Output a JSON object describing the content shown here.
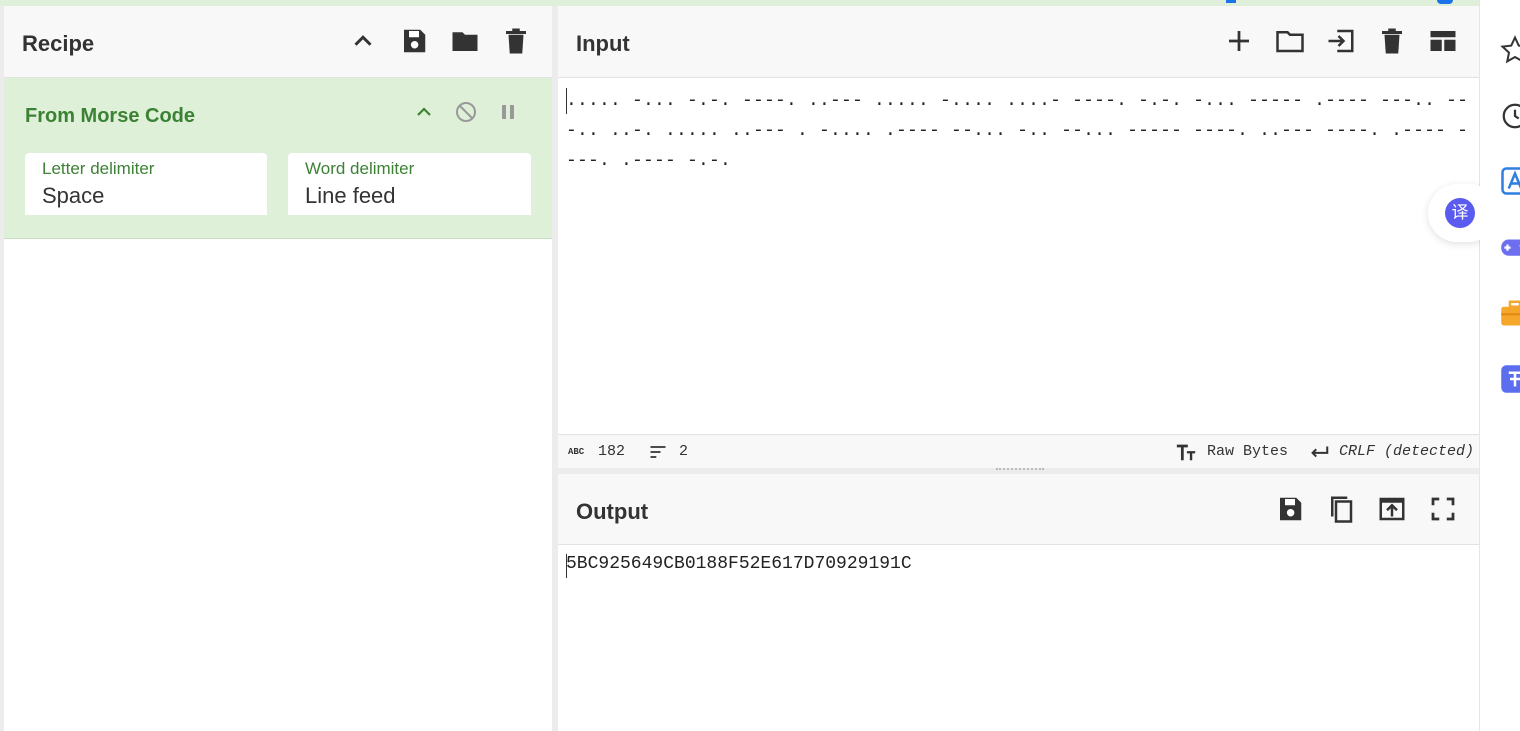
{
  "recipe": {
    "title": "Recipe",
    "icons": [
      "chevron-up-icon",
      "save-icon",
      "folder-icon",
      "trash-icon"
    ],
    "operation": {
      "name": "From Morse Code",
      "args": [
        {
          "label": "Letter delimiter",
          "value": "Space"
        },
        {
          "label": "Word delimiter",
          "value": "Line feed"
        }
      ]
    }
  },
  "input": {
    "title": "Input",
    "text": "..... -... -.-. ----. ..--- ..... -.... ....- ----. -.-. -... ----- .---- ---.. ---.. ..-. ..... ..--- . -.... .---- --... -.. --... ----- ----. ..--- ----. .---- ----. .---- -.-.",
    "status": {
      "length_label": "ABC",
      "length": "182",
      "lines": "2",
      "format": "Raw Bytes",
      "eol": "CRLF (detected)"
    }
  },
  "output": {
    "title": "Output",
    "text": "5BC925649CB0188F52E617D70929191C"
  },
  "sidepanel": {
    "translate_glyph": "译"
  },
  "colors": {
    "accent_green": "#3c8234",
    "op_bg": "#dff0d8",
    "panel_bg": "#f8f8f8"
  }
}
